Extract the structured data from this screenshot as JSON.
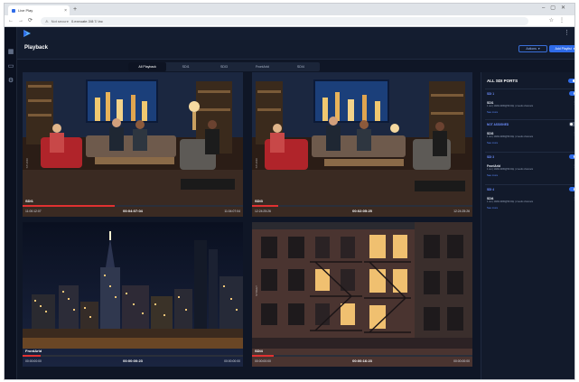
{
  "browser": {
    "tab_title": "Live Play",
    "url_security": "Not secure",
    "url": "0.exeuate.3/8:7/.inc"
  },
  "app": {
    "page_title": "Playback",
    "actions_button": "Actions",
    "add_playlist_button": "Add Playlist",
    "colors": {
      "accent": "#2f6be8",
      "progress": "#e03131",
      "background": "#0f1626"
    }
  },
  "tabs": [
    {
      "label": "All Playback",
      "active": true
    },
    {
      "label": "SDI1",
      "active": false
    },
    {
      "label": "SDI3",
      "active": false
    },
    {
      "label": "FrontArld",
      "active": false
    },
    {
      "label": "SDI4",
      "active": false
    }
  ],
  "players": [
    {
      "name": "SDI1",
      "time_start": "11:00:12:07",
      "time_current": "00:04:07:04",
      "time_end": "11:04:07:04",
      "progress": 0.42,
      "scene": "studio"
    },
    {
      "name": "SDI3",
      "time_start": "12:24:25:26",
      "time_current": "00:02:05:25",
      "time_end": "12:24:25:26",
      "progress": 0.12,
      "scene": "studio"
    },
    {
      "name": "FrontArld",
      "time_start": "00:00:00:00",
      "time_current": "00:00:00:23",
      "time_end": "00:00:00:00",
      "progress": 0.08,
      "scene": "skyline"
    },
    {
      "name": "SDI4",
      "time_start": "00:00:00:00",
      "time_current": "00:00:16:23",
      "time_end": "00:00:00:00",
      "progress": 0.1,
      "scene": "building"
    }
  ],
  "ports_panel": {
    "title": "ALL SDI PORTS",
    "all_enabled": true,
    "ports": [
      {
        "port": "SDI 1",
        "enabled": true,
        "source": "SDI1",
        "format": "1 out | 1920x1080@59.94p | 2 audio channels",
        "see_more": "See more"
      },
      {
        "port": "NOT ASSIGNED",
        "enabled": false,
        "source": "SDI3",
        "format": "1 out | 1920x1080@59.94p | 2 audio channels",
        "see_more": "See more"
      },
      {
        "port": "SDI 3",
        "enabled": true,
        "source": "FrontArld",
        "format": "1 out | 1920x1080@59.94p | 2 audio channels",
        "see_more": "See more"
      },
      {
        "port": "SDI 4",
        "enabled": true,
        "source": "SDI4",
        "format": "1 out | 1920x1080@59.94p | 2 audio channels",
        "see_more": "See more"
      }
    ]
  }
}
